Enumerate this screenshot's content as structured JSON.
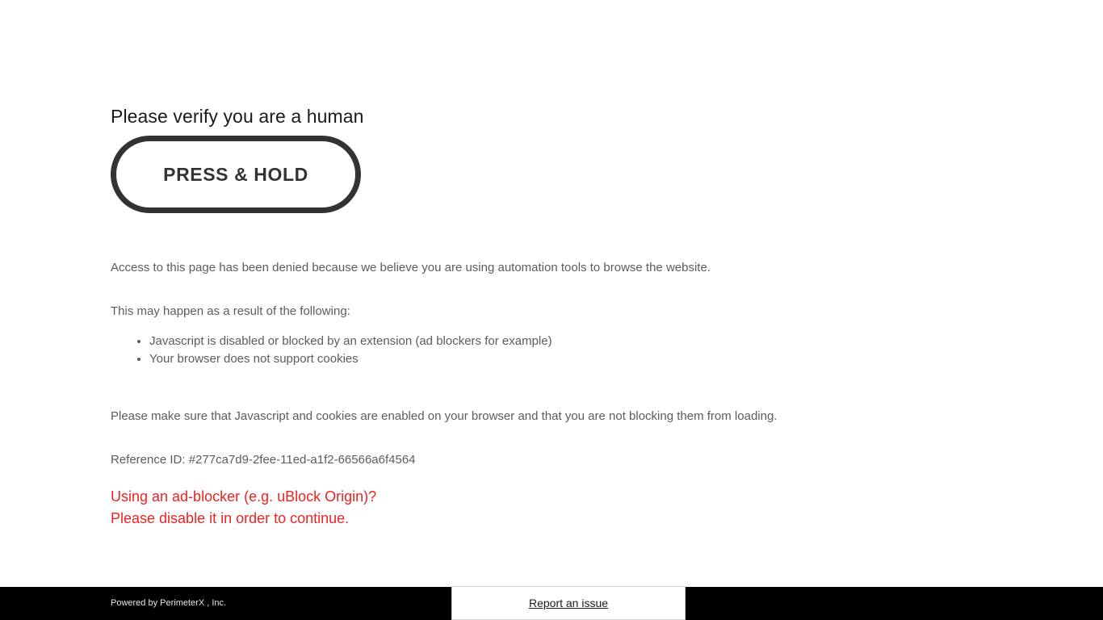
{
  "page": {
    "heading": "Please verify you are a human",
    "background_color": "#ffffff"
  },
  "verify_button": {
    "label": "PRESS & HOLD",
    "border_color": "#333333",
    "text_color": "#333333"
  },
  "messages": {
    "denied": "Access to this page has been denied because we believe you are using automation tools to browse the website.",
    "may_happen": "This may happen as a result of the following:",
    "reasons": [
      "Javascript is disabled or blocked by an extension (ad blockers for example)",
      "Your browser does not support cookies"
    ],
    "make_sure": "Please make sure that Javascript and cookies are enabled on your browser and that you are not blocking them from loading.",
    "reference_id": "Reference ID: #277ca7d9-2fee-11ed-a1f2-66566a6f4564",
    "text_color": "#5c5c5c"
  },
  "adblock_warning": {
    "line1": "Using an ad-blocker (e.g. uBlock Origin)?",
    "line2": "Please disable it in order to continue.",
    "color": "#ee2222"
  },
  "footer": {
    "credit": "Powered by PerimeterX , Inc.",
    "report_label": "Report an issue",
    "background_color": "#000000"
  }
}
